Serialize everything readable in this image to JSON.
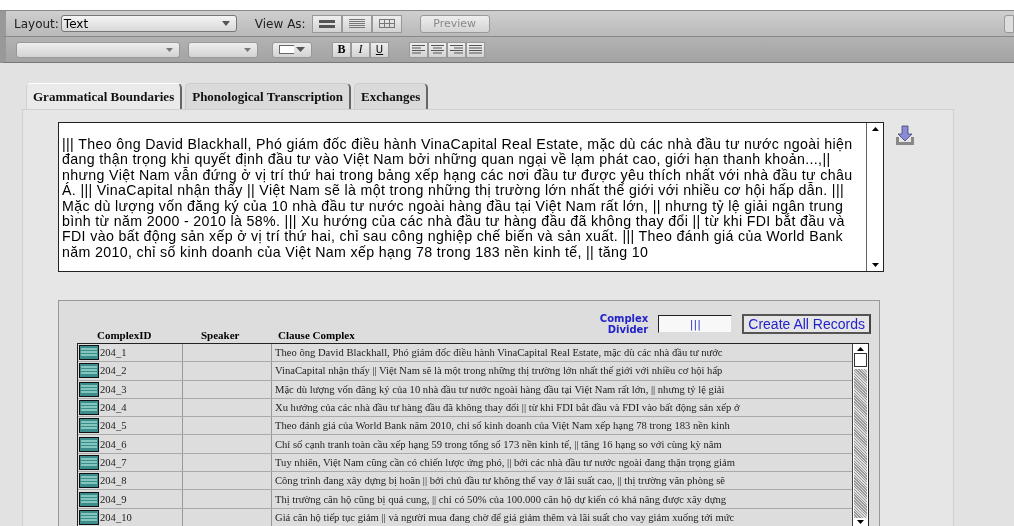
{
  "toolbar": {
    "layout_label": "Layout:",
    "layout_value": "Text",
    "view_as_label": "View As:",
    "preview_button": "Preview",
    "format_buttons": [
      "B",
      "I",
      "U"
    ]
  },
  "tabs": [
    {
      "label": "Grammatical Boundaries",
      "selected": true
    },
    {
      "label": "Phonological Transcription",
      "selected": false
    },
    {
      "label": "Exchanges",
      "selected": false
    }
  ],
  "text_area": {
    "text": "||| Theo ông David Blackhall, Phó giám đốc điều hành VinaCapital Real Estate, mặc dù các nhà đầu tư nước ngoài hiện đang thận trọng khi quyết định đầu tư vào Việt Nam bởi những quan ngại về lạm phát cao, giới hạn thanh khoản...,||  nhưng Việt Nam vẫn đứng ở vị trí thứ hai trong bảng xếp hạng các nơi đầu tư được yêu thích nhất với nhà đầu tư châu Á. ||| VinaCapital nhận thấy || Việt Nam sẽ là một trong những thị trường lớn nhất thế giới với nhiều cơ hội hấp dẫn. ||| Mặc dù lượng vốn đăng ký của 10 nhà đầu tư nước ngoài hàng đầu tại Việt Nam rất lớn, || nhưng tỷ lệ giải ngân trung bình từ năm 2000 - 2010 là 58%. ||| Xu hướng của các nhà đầu tư hàng đầu đã không thay đổi || từ khi FDI bắt đầu và FDI vào bất động sản xếp ở vị trí thứ hai, chỉ sau công nghiệp chế biến và sản xuất. ||| Theo đánh giá của World Bank năm 2010, chỉ số kinh doanh của Việt Nam xếp hạng 78 trong 183 nền kinh tế, || tăng 10"
  },
  "divider": {
    "label": "Complex Divider",
    "value": "|||",
    "create_button": "Create All Records"
  },
  "table": {
    "columns": [
      "ComplexID",
      "Speaker",
      "Clause Complex"
    ],
    "rows": [
      {
        "id": "204_1",
        "clause": "Theo ông David Blackhall, Phó giám đốc điều hành VinaCapital Real Estate, mặc dù các nhà đầu tư nước"
      },
      {
        "id": "204_2",
        "clause": "VinaCapital nhận thấy || Việt Nam sẽ là một trong những thị trường lớn nhất thế giới với nhiều cơ hội hấp"
      },
      {
        "id": "204_3",
        "clause": "Mặc dù lượng vốn đăng ký của 10 nhà đầu tư nước ngoài hàng đầu tại Việt Nam rất lớn, || nhưng tỷ lệ giải"
      },
      {
        "id": "204_4",
        "clause": "Xu hướng của các nhà đầu tư hàng đầu đã không thay đổi || từ khi FDI bắt đầu và FDI vào bất động sản xếp ở"
      },
      {
        "id": "204_5",
        "clause": "Theo đánh giá của World Bank năm 2010, chỉ số kinh doanh của Việt Nam xếp hạng 78 trong 183 nền kinh"
      },
      {
        "id": "204_6",
        "clause": "Chỉ số cạnh tranh toàn cầu xếp hạng 59 trong tổng số 173 nền kinh tế, || tăng 16 hạng so với cùng kỳ năm"
      },
      {
        "id": "204_7",
        "clause": "Tuy nhiên, Việt Nam cũng cần có chiến lược ứng phó, || bởi các nhà đầu tư nước ngoài đang thận trọng giảm"
      },
      {
        "id": "204_8",
        "clause": "Công trình đang xây dựng bị hoãn || bởi chủ đầu tư không thể vay ở lãi suất cao, || thị trường văn phòng sẽ"
      },
      {
        "id": "204_9",
        "clause": "Thị trường căn hộ cũng bị quá cung, || chỉ có 50% của 100.000 căn hộ dự kiến có khả năng được xây dựng"
      },
      {
        "id": "204_10",
        "clause": "Giá căn hộ tiếp tục giảm || và người mua đang chờ để giá giảm thêm và lãi suất cho vay giảm xuống tới mức"
      }
    ]
  }
}
